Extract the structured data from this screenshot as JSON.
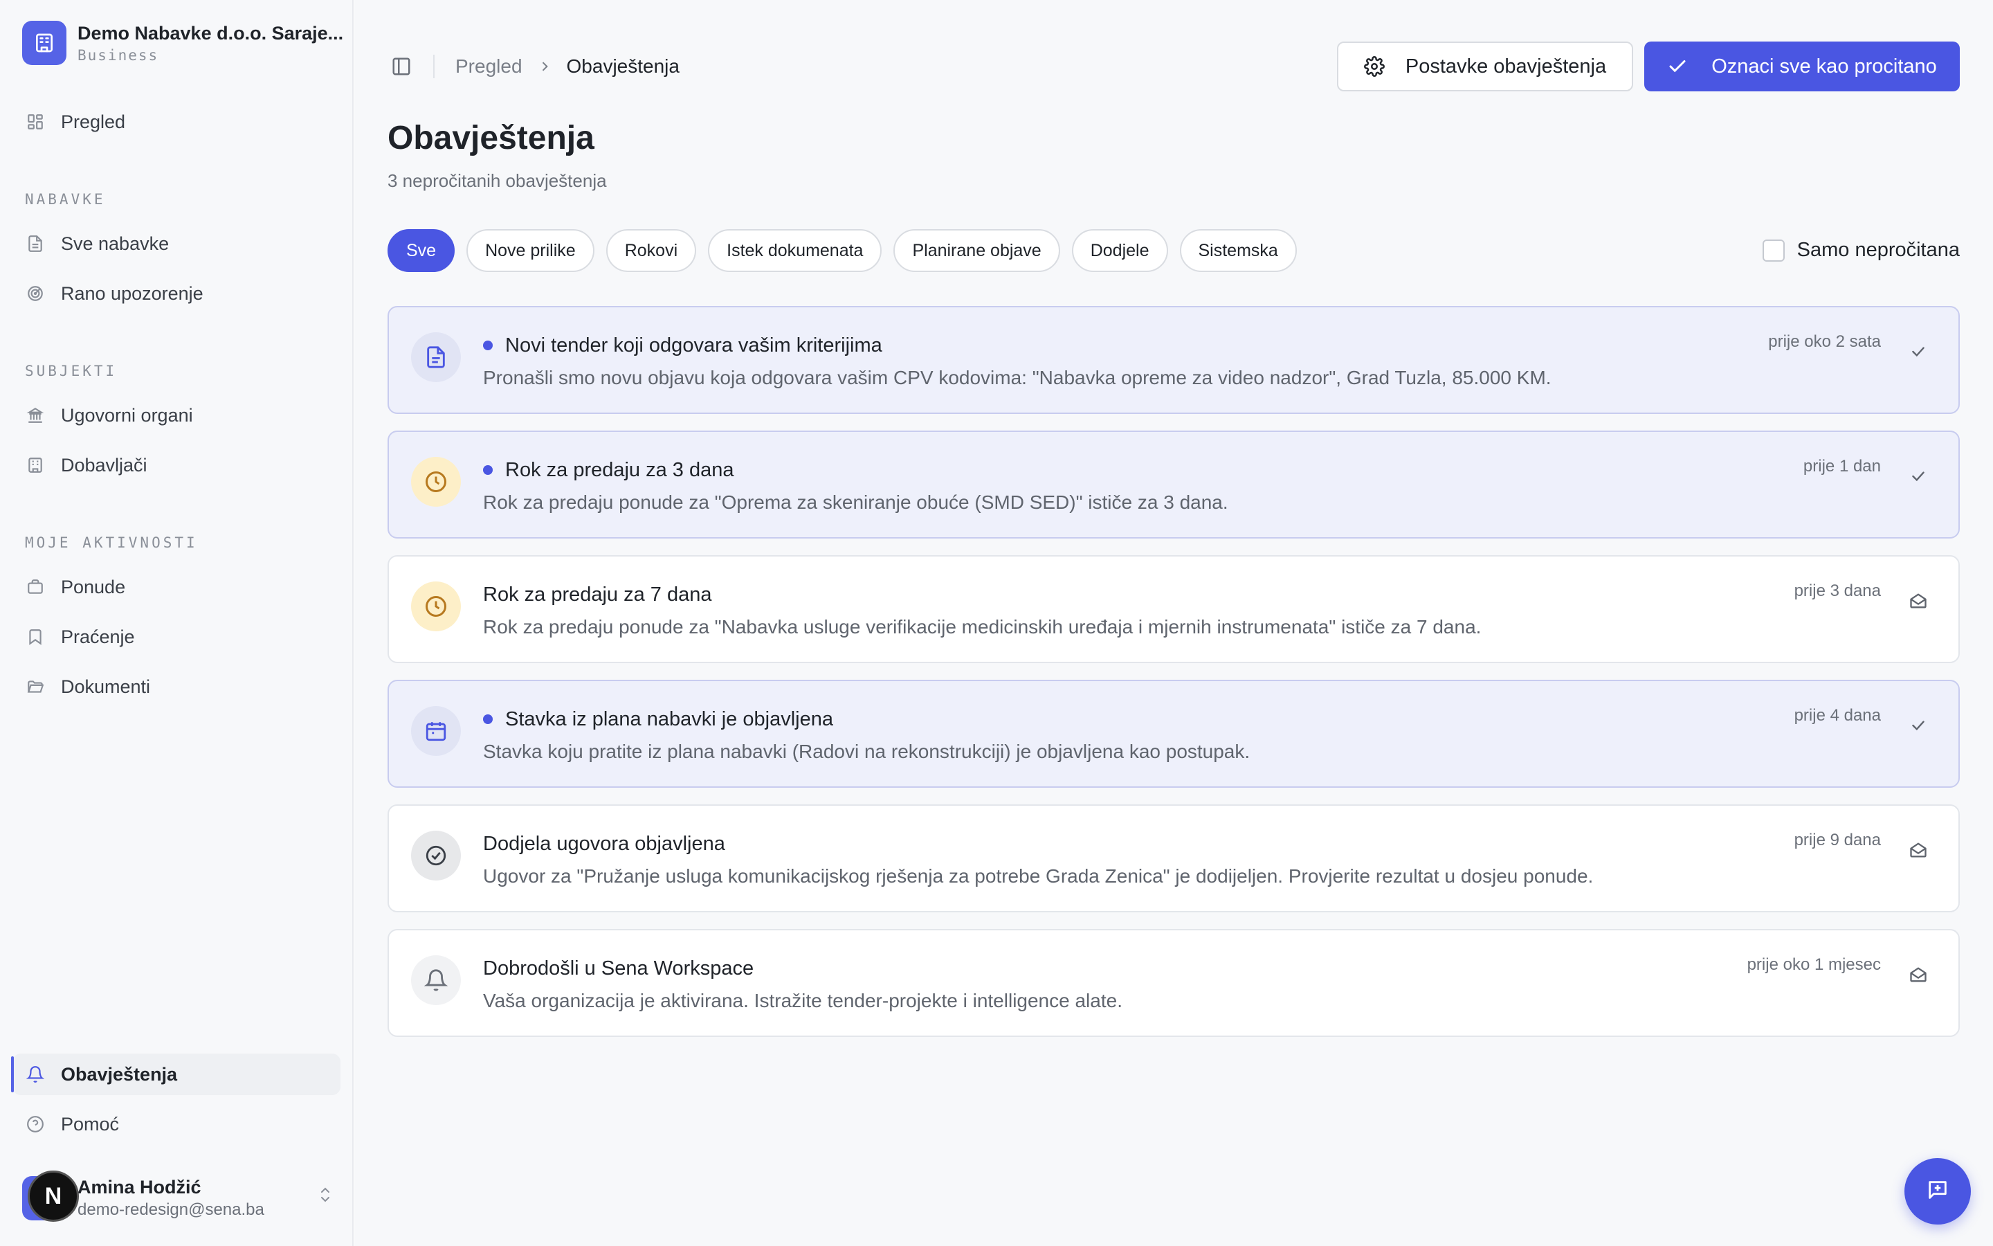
{
  "org": {
    "name": "Demo Nabavke d.o.o. Saraje...",
    "plan": "Business"
  },
  "sidebar": {
    "overview": "Pregled",
    "section_procurements": "NABAVKE",
    "all_procurements": "Sve nabavke",
    "early_warning": "Rano upozorenje",
    "section_subjects": "SUBJEKTI",
    "contracting_authorities": "Ugovorni organi",
    "suppliers": "Dobavljači",
    "section_activities": "MOJE AKTIVNOSTI",
    "bids": "Ponude",
    "tracking": "Praćenje",
    "documents": "Dokumenti",
    "notifications": "Obavještenja",
    "help": "Pomoć"
  },
  "user": {
    "initial": "N",
    "name": "Amina Hodžić",
    "email": "demo-redesign@sena.ba"
  },
  "breadcrumb": {
    "parent": "Pregled",
    "current": "Obavještenja"
  },
  "header": {
    "settings_button": "Postavke obavještenja",
    "mark_all_button": "Oznaci sve kao procitano",
    "title": "Obavještenja",
    "subtitle": "3 nepročitanih obavještenja"
  },
  "filters": {
    "all": "Sve",
    "new_opportunities": "Nove prilike",
    "deadlines": "Rokovi",
    "document_expiry": "Istek dokumenata",
    "planned": "Planirane objave",
    "awards": "Dodjele",
    "system": "Sistemska",
    "unread_only": "Samo nepročitana"
  },
  "notifications": [
    {
      "title": "Novi tender koji odgovara vašim kriterijima",
      "desc": "Pronašli smo novu objavu koja odgovara vašim CPV kodovima: \"Nabavka opreme za video nadzor\", Grad Tuzla, 85.000 KM.",
      "time": "prije oko 2 sata",
      "icon": "document-icon",
      "unread": true
    },
    {
      "title": "Rok za predaju za 3 dana",
      "desc": "Rok za predaju ponude za \"Oprema za skeniranje obuće (SMD SED)\" ističe za 3 dana.",
      "time": "prije 1 dan",
      "icon": "clock-icon",
      "unread": true
    },
    {
      "title": "Rok za predaju za 7 dana",
      "desc": "Rok za predaju ponude za \"Nabavka usluge verifikacije medicinskih uređaja i mjernih instrumenata\" ističe za 7 dana.",
      "time": "prije 3 dana",
      "icon": "clock-icon",
      "unread": false
    },
    {
      "title": "Stavka iz plana nabavki je objavljena",
      "desc": "Stavka koju pratite iz plana nabavki (Radovi na rekonstrukciji) je objavljena kao postupak.",
      "time": "prije 4 dana",
      "icon": "calendar-icon",
      "unread": true
    },
    {
      "title": "Dodjela ugovora objavljena",
      "desc": "Ugovor za \"Pružanje usluga komunikacijskog rješenja za potrebe Grada Zenica\" je dodijeljen. Provjerite rezultat u dosjeu ponude.",
      "time": "prije 9 dana",
      "icon": "check-circle-icon",
      "unread": false
    },
    {
      "title": "Dobrodošli u Sena Workspace",
      "desc": "Vaša organizacija je aktivirana. Istražite tender-projekte i intelligence alate.",
      "time": "prije oko 1 mjesec",
      "icon": "bell-icon",
      "unread": false
    }
  ],
  "colors": {
    "accent": "#4a56e2",
    "unread_bg": "#eef0fb",
    "sidebar_bg": "#f7f8fa"
  }
}
